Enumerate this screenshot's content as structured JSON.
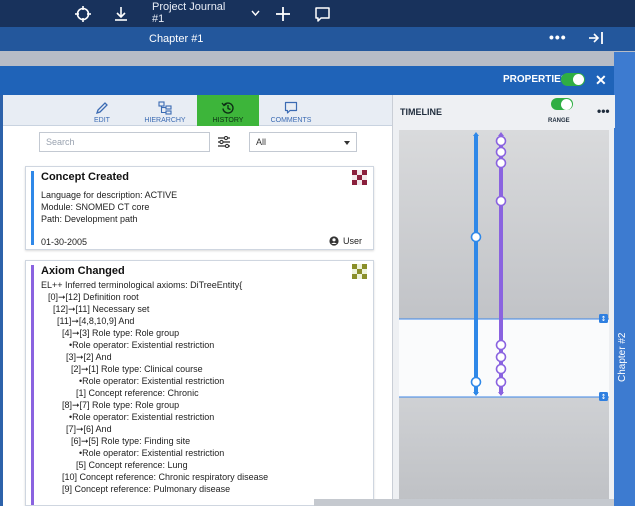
{
  "topbar": {
    "project_select": "Project Journal #1",
    "icons": [
      "crosshair-icon",
      "download-icon",
      "chevron-down-icon",
      "plus-icon",
      "comment-icon"
    ]
  },
  "chapter_bar": {
    "title": "Chapter #1",
    "more": "•••"
  },
  "properties_bar": {
    "label": "PROPERTIES",
    "toggle_on": true,
    "close": "✕"
  },
  "side_tab": {
    "label": "Chapter #2"
  },
  "tabs": [
    {
      "label": "EDIT",
      "icon": "pencil-icon",
      "active": false
    },
    {
      "label": "HIERARCHY",
      "icon": "hierarchy-icon",
      "active": false
    },
    {
      "label": "HISTORY",
      "icon": "history-icon",
      "active": true
    },
    {
      "label": "COMMENTS",
      "icon": "comment-icon",
      "active": false
    }
  ],
  "filter": {
    "search_placeholder": "Search",
    "select_value": "All"
  },
  "cards": [
    {
      "title": "Concept Created",
      "accent": "#2f88e8",
      "lines": [
        "Language for description: ACTIVE",
        "Module: SNOMED CT core",
        "Path: Development path"
      ],
      "date": "01-30-2005",
      "user": "User"
    },
    {
      "title": "Axiom Changed",
      "accent": "#8a63e0",
      "lines": [
        "EL++ Inferred terminological axioms: DiTreeEntity{",
        "[0]➞[12] Definition root",
        "[12]➞[11] Necessary set",
        "[11]➞[4,8,10,9] And",
        "[4]➞[3] Role type: Role group",
        "•Role operator: Existential restriction",
        "[3]➞[2] And",
        "[2]➞[1] Role type: Clinical course",
        "•Role operator: Existential restriction",
        "[1] Concept reference: Chronic",
        "[8]➞[7] Role type: Role group",
        "•Role operator: Existential restriction",
        "[7]➞[6] And",
        "[6]➞[5] Role type: Finding site",
        "•Role operator: Existential restriction",
        "[5] Concept reference: Lung",
        "[10] Concept reference: Chronic respiratory disease",
        "[9] Concept reference: Pulmonary disease"
      ]
    }
  ],
  "timeline": {
    "title": "TIMELINE",
    "range_label": "RANGE",
    "range_on": true,
    "more": "•••",
    "colors": {
      "blue": "#2f88e8",
      "purple": "#8a63e0"
    }
  }
}
